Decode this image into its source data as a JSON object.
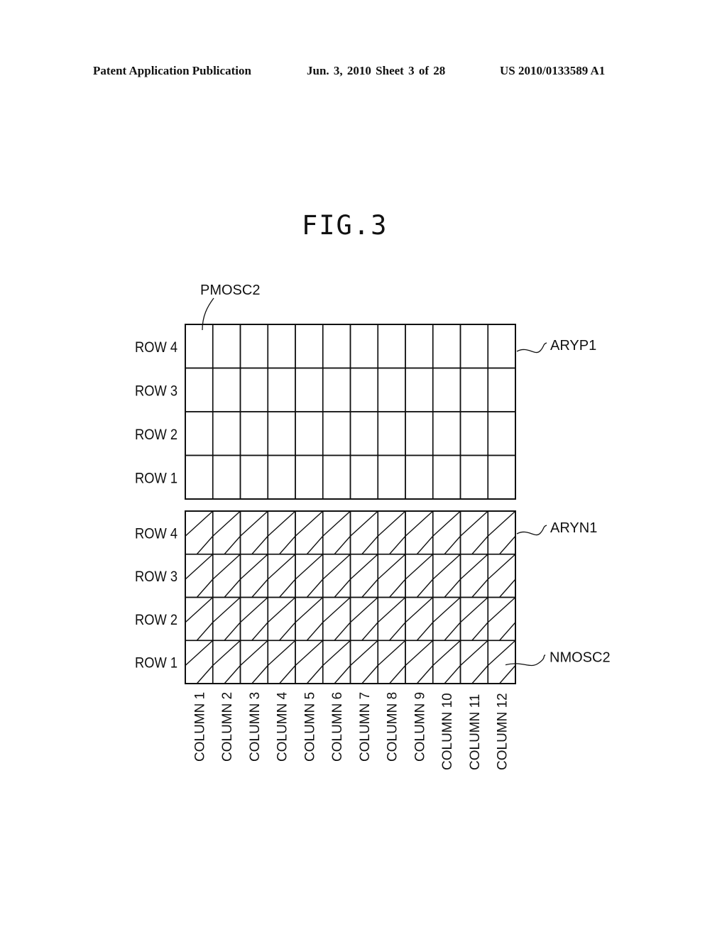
{
  "header": {
    "left": "Patent Application Publication",
    "center": "Jun. 3, 2010   Sheet 3 of 28",
    "right": "US 2010/0133589 A1"
  },
  "figure": {
    "title": "FIG.3",
    "arrays": [
      {
        "id": "ARYP1",
        "label": "ARYP1",
        "hatched": false,
        "cell_label": "PMOSC2",
        "cell_label_target": {
          "row": 4,
          "column": 1
        }
      },
      {
        "id": "ARYN1",
        "label": "ARYN1",
        "hatched": true,
        "cell_label": "NMOSC2",
        "cell_label_target": {
          "row": 1,
          "column": 12
        }
      }
    ],
    "rows": [
      "ROW 4",
      "ROW 3",
      "ROW 2",
      "ROW 1"
    ],
    "columns": [
      "COLUMN 1",
      "COLUMN 2",
      "COLUMN 3",
      "COLUMN 4",
      "COLUMN 5",
      "COLUMN 6",
      "COLUMN 7",
      "COLUMN 8",
      "COLUMN 9",
      "COLUMN 10",
      "COLUMN 11",
      "COLUMN 12"
    ]
  },
  "colors": {
    "ink": "#111111",
    "paper": "#ffffff"
  }
}
